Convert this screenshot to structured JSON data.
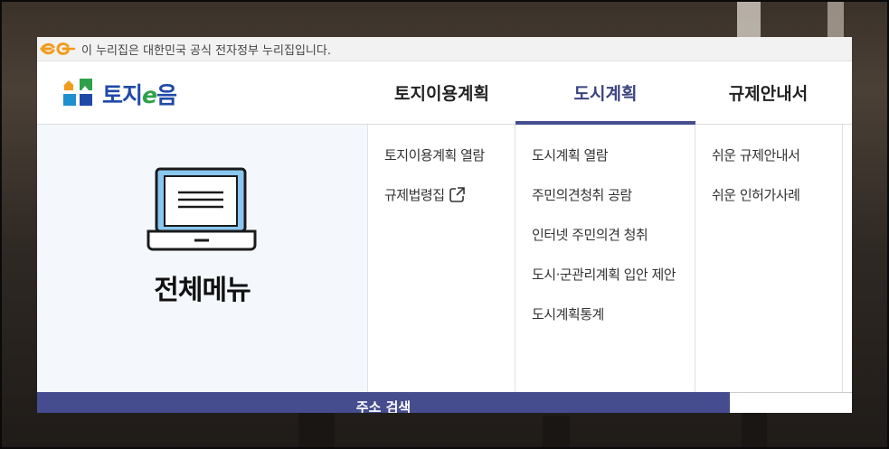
{
  "gov_banner": {
    "text": "이 누리집은 대한민국 공식 전자정부 누리집입니다."
  },
  "brand": {
    "logo_prefix": "토지",
    "logo_e": "e",
    "logo_suffix": "음"
  },
  "gnb": [
    {
      "label": "토지이용계획",
      "active": false
    },
    {
      "label": "도시계획",
      "active": true
    },
    {
      "label": "규제안내서",
      "active": false
    }
  ],
  "allmenu": {
    "label": "전체메뉴",
    "icon": "laptop-icon"
  },
  "submenus": [
    {
      "items": [
        "토지이용계획 열람",
        "규제법령집"
      ],
      "external_icon": "external-link-icon"
    },
    {
      "items": [
        "도시계획 열람",
        "주민의견청취 공람",
        "인터넷 주민의견 청취",
        "도시·군관리계획 입안 제안",
        "도시계획통계"
      ]
    },
    {
      "items": [
        "쉬운 규제안내서",
        "쉬운 인허가사례"
      ]
    }
  ],
  "search_bar": {
    "label": "주소 검색"
  },
  "colors": {
    "accent": "#454d8f",
    "brand_blue": "#1f4aa8",
    "gov_logo": "#f29b1d",
    "allmenu_bg": "#f4f8fd"
  }
}
